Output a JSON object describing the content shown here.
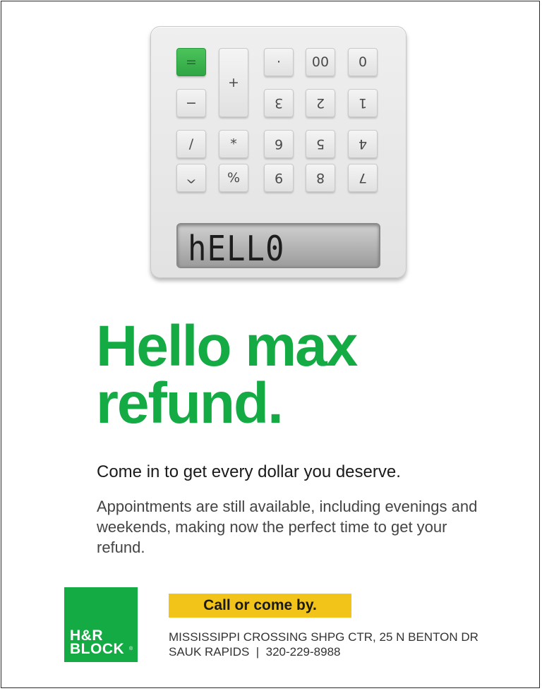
{
  "calculator": {
    "keys": {
      "equals": "=",
      "plus": "+",
      "dot": "·",
      "double_zero": "00",
      "zero": "0",
      "minus": "−",
      "three": "3",
      "two": "2",
      "one": "1",
      "divide": "/",
      "multiply": "*",
      "six": "6",
      "five": "5",
      "four": "4",
      "caret": "^",
      "percent": "%",
      "nine": "9",
      "eight": "8",
      "seven": "7"
    },
    "display": "hELL0"
  },
  "ad": {
    "headline": "Hello max refund.",
    "subhead": "Come in to get every dollar you deserve.",
    "body": "Appointments are still available, including evenings and weekends, making now the perfect time to get your refund.",
    "cta": "Call or come by.",
    "address_line1": "MISSISSIPPI CROSSING SHPG CTR, 25 N BENTON DR",
    "address_line2": "SAUK RAPIDS  |  320-229-8988"
  },
  "logo": {
    "line1": "H&R",
    "line2": "BLOCK",
    "reg": "®"
  },
  "colors": {
    "brand_green": "#14aa44",
    "cta_yellow": "#f2c419"
  }
}
